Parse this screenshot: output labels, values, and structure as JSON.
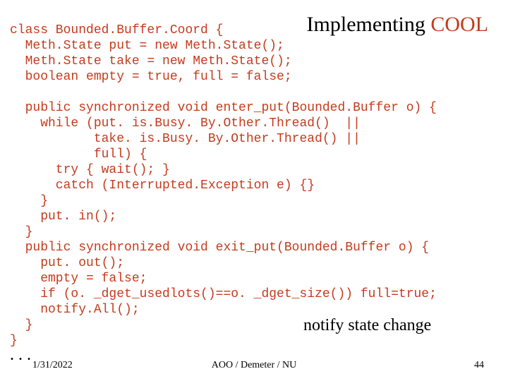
{
  "title": {
    "left": "Implementing ",
    "right": "COOL"
  },
  "code": "class Bounded.Buffer.Coord {\n  Meth.State put = new Meth.State();\n  Meth.State take = new Meth.State();\n  boolean empty = true, full = false;\n\n  public synchronized void enter_put(Bounded.Buffer o) {\n    while (put. is.Busy. By.Other.Thread()  ||\n           take. is.Busy. By.Other.Thread() ||\n           full) {\n      try { wait(); }\n      catch (Interrupted.Exception e) {}\n    }\n    put. in();\n  }\n  public synchronized void exit_put(Bounded.Buffer o) {\n    put. out();\n    empty = false;\n    if (o. _dget_usedlots()==o. _dget_size()) full=true;\n    notify.All();\n  }\n}",
  "note": "notify state change",
  "dots": ". . .",
  "footer": {
    "date": "1/31/2022",
    "center": "AOO / Demeter / NU",
    "page": "44"
  }
}
